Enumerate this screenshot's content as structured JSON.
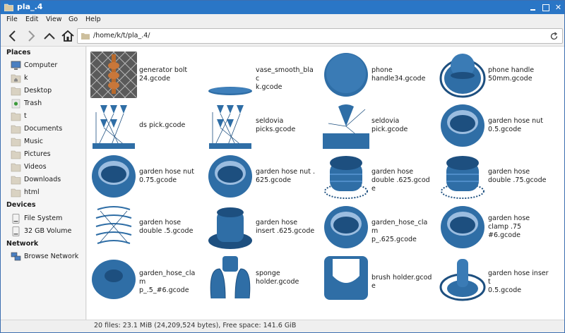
{
  "window": {
    "title": "pla_.4"
  },
  "menu": [
    "File",
    "Edit",
    "View",
    "Go",
    "Help"
  ],
  "location": {
    "path": "/home/k/t/pla_.4/"
  },
  "sidebar": {
    "places_header": "Places",
    "places": [
      {
        "label": "Computer",
        "icon": "computer-icon"
      },
      {
        "label": "k",
        "icon": "home-folder-icon"
      },
      {
        "label": "Desktop",
        "icon": "folder-icon"
      },
      {
        "label": "Trash",
        "icon": "trash-icon"
      },
      {
        "label": "t",
        "icon": "folder-icon"
      },
      {
        "label": "Documents",
        "icon": "folder-icon"
      },
      {
        "label": "Music",
        "icon": "folder-icon"
      },
      {
        "label": "Pictures",
        "icon": "folder-icon"
      },
      {
        "label": "Videos",
        "icon": "folder-icon"
      },
      {
        "label": "Downloads",
        "icon": "folder-icon"
      },
      {
        "label": "html",
        "icon": "folder-icon"
      }
    ],
    "devices_header": "Devices",
    "devices": [
      {
        "label": "File System",
        "icon": "drive-icon"
      },
      {
        "label": "32 GB Volume",
        "icon": "drive-icon"
      }
    ],
    "network_header": "Network",
    "network": [
      {
        "label": "Browse Network",
        "icon": "network-icon"
      }
    ]
  },
  "files": [
    {
      "name": "generator bolt 24.gcode",
      "lines": [
        "generator bolt",
        "24.gcode"
      ],
      "thumb": "bolt"
    },
    {
      "name": "vase_smooth_black.gcode",
      "lines": [
        "vase_smooth_blac",
        "k.gcode"
      ],
      "thumb": "flat"
    },
    {
      "name": "phone handle34.gcode",
      "lines": [
        "phone",
        "handle34.gcode"
      ],
      "thumb": "disc"
    },
    {
      "name": "phone handle 50mm.gcode",
      "lines": [
        "phone handle",
        "50mm.gcode"
      ],
      "thumb": "knob"
    },
    {
      "name": "ds pick.gcode",
      "lines": [
        "ds pick.gcode"
      ],
      "thumb": "picks"
    },
    {
      "name": "seldovia picks.gcode",
      "lines": [
        "seldovia",
        "picks.gcode"
      ],
      "thumb": "picks"
    },
    {
      "name": "seldovia pick.gcode",
      "lines": [
        "seldovia",
        "pick.gcode"
      ],
      "thumb": "pick"
    },
    {
      "name": "garden hose nut 0.5.gcode",
      "lines": [
        "garden hose nut",
        "0.5.gcode"
      ],
      "thumb": "ring"
    },
    {
      "name": "garden hose nut 0.75.gcode",
      "lines": [
        "garden hose nut",
        "0.75.gcode"
      ],
      "thumb": "ring"
    },
    {
      "name": "garden hose nut .625.gcode",
      "lines": [
        "garden hose nut .",
        "625.gcode"
      ],
      "thumb": "ring"
    },
    {
      "name": "garden hose double .625.gcode",
      "lines": [
        "garden hose",
        "double .625.gcode"
      ],
      "thumb": "double"
    },
    {
      "name": "garden hose double .75.gcode",
      "lines": [
        "garden hose",
        "double .75.gcode"
      ],
      "thumb": "double"
    },
    {
      "name": "garden hose double .5.gcode",
      "lines": [
        "garden hose",
        "double .5.gcode"
      ],
      "thumb": "wire"
    },
    {
      "name": "garden hose insert .625.gcode",
      "lines": [
        "garden hose",
        "insert .625.gcode"
      ],
      "thumb": "insert"
    },
    {
      "name": "garden_hose_clamp_.625.gcode",
      "lines": [
        "garden_hose_clam",
        "p_.625.gcode"
      ],
      "thumb": "ring"
    },
    {
      "name": "garden hose clamp .75 #6.gcode",
      "lines": [
        "garden hose",
        "clamp .75",
        "#6.gcode"
      ],
      "thumb": "ring"
    },
    {
      "name": "garden_hose_clamp_.5_#6.gcode",
      "lines": [
        "garden_hose_clam",
        "p_.5_#6.gcode"
      ],
      "thumb": "donut"
    },
    {
      "name": "sponge holder.gcode",
      "lines": [
        "sponge",
        "holder.gcode"
      ],
      "thumb": "sponge"
    },
    {
      "name": "brush holder.gcode",
      "lines": [
        "brush holder.gcode"
      ],
      "thumb": "brush"
    },
    {
      "name": "garden hose insert 0.5.gcode",
      "lines": [
        "garden hose insert",
        "0.5.gcode"
      ],
      "thumb": "insert2"
    }
  ],
  "status": "20 files: 23.1  MiB (24,209,524 bytes), Free space: 141.6  GiB",
  "colors": {
    "titlebar": "#2a76c6",
    "model": "#2f6ea6",
    "model_dark": "#1d4f7f"
  }
}
